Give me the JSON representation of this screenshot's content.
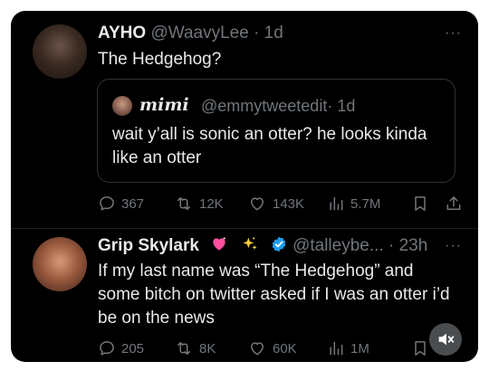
{
  "tweet1": {
    "name": "AYHO",
    "handle": "@WaavyLee",
    "time": "· 1d",
    "text": "The Hedgehog?",
    "more": "···",
    "quote": {
      "name": "mimi",
      "handle": "@emmytweetedit",
      "time": "· 1d",
      "text": "wait y’all is sonic an otter? he looks kinda like an otter"
    },
    "stats": {
      "replies": "367",
      "reposts": "12K",
      "likes": "143K",
      "views": "5.7M"
    }
  },
  "tweet2": {
    "name": "Grip Skylark",
    "handle": "@talleybe...",
    "time": "· 23h",
    "text": "If my last name was “The Hedgehog” and some bitch on twitter asked if I was an otter i’d be on the news",
    "more": "···",
    "stats": {
      "replies": "205",
      "reposts": "8K",
      "likes": "60K",
      "views": "1M"
    }
  },
  "colors": {
    "background": "#000000",
    "text": "#e7e9ea",
    "muted": "#71767b",
    "verified": "#1d9bf0",
    "border": "#2f3336"
  },
  "icons": [
    "reply-icon",
    "repost-icon",
    "like-icon",
    "views-icon",
    "bookmark-icon",
    "share-icon",
    "verified-icon",
    "mute-icon"
  ]
}
